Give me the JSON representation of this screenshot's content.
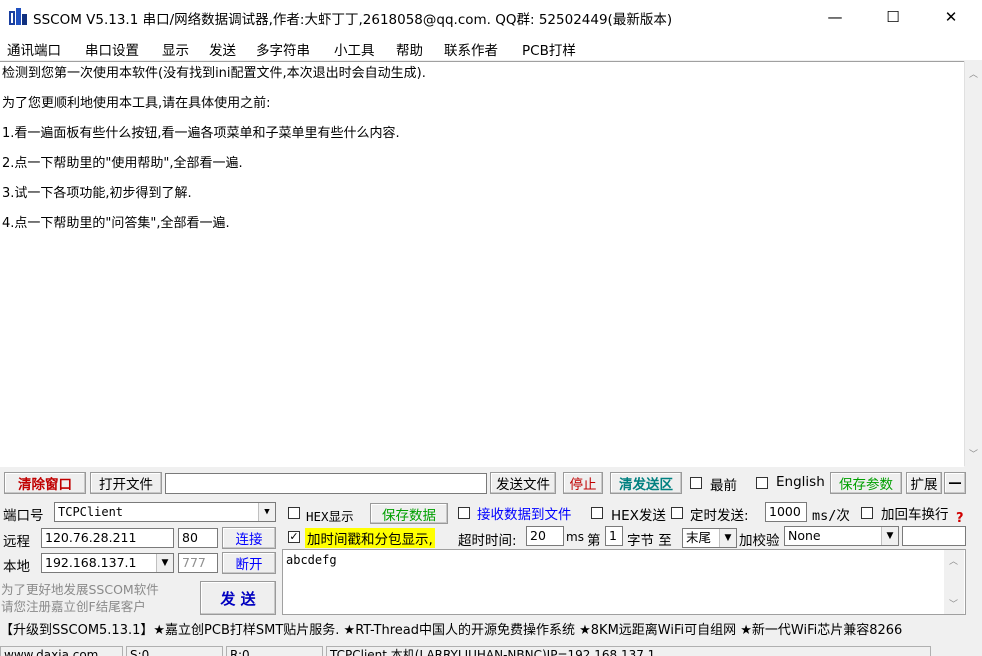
{
  "window": {
    "title": "SSCOM V5.13.1 串口/网络数据调试器,作者:大虾丁丁,2618058@qq.com. QQ群:  52502449(最新版本)",
    "minimize_glyph": "—",
    "maximize_glyph": "☐",
    "close_glyph": "✕"
  },
  "menu": [
    "通讯端口",
    "串口设置",
    "显示",
    "发送",
    "多字符串",
    "小工具",
    "帮助",
    "联系作者",
    "PCB打样"
  ],
  "receive": {
    "lines": [
      "检测到您第一次使用本软件(没有找到ini配置文件,本次退出时会自动生成).",
      "为了您更顺利地使用本工具,请在具体使用之前:",
      "1.看一遍面板有些什么按钮,看一遍各项菜单和子菜单里有些什么内容.",
      "2.点一下帮助里的\"使用帮助\",全部看一遍.",
      "3.试一下各项功能,初步得到了解.",
      "4.点一下帮助里的\"问答集\",全部看一遍."
    ]
  },
  "toolbar": {
    "clear_window": "清除窗口",
    "open_file": "打开文件",
    "file_path": "",
    "send_file": "发送文件",
    "stop": "停止",
    "clear_send": "清发送区",
    "topmost": "最前",
    "english": "English",
    "save_params": "保存参数",
    "expand": "扩展",
    "collapse": "—"
  },
  "connection": {
    "port_label": "端口号",
    "port_value": "TCPClient",
    "remote_label": "远程",
    "remote_ip": "120.76.28.211",
    "remote_port": "80",
    "connect": "连接",
    "local_label": "本地",
    "local_ip": "192.168.137.1",
    "local_port": "777",
    "disconnect": "断开",
    "promo": "为了更好地发展SSCOM软件\n请您注册嘉立创F结尾客户",
    "send": "发 送"
  },
  "options": {
    "hex_display": "HEX显示",
    "save_data": "保存数据",
    "recv_to_file": "接收数据到文件",
    "hex_send": "HEX发送",
    "timed_send": "定时发送:",
    "interval": "1000",
    "interval_unit": "ms/次",
    "add_crlf": "加回车换行",
    "timestamp": "加时间戳和分包显示,",
    "timeout_label": "超时时间:",
    "timeout_value": "20",
    "timeout_unit": "ms",
    "byte_prefix": "第",
    "byte_value": "1",
    "byte_to": "字节 至",
    "end_value": "末尾",
    "checksum_label": "加校验",
    "checksum_value": "None",
    "help_mark": "?"
  },
  "send_area": {
    "text": "abcdefg"
  },
  "ticker": "【升级到SSCOM5.13.1】★嘉立创PCB打样SMT贴片服务. ★RT-Thread中国人的开源免费操作系统 ★8KM远距离WiFi可自组网 ★新一代WiFi芯片兼容8266",
  "status": {
    "website": "www.daxia.com",
    "sent": "S:0",
    "received": "R:0",
    "connection_info": "TCPClient 本机(LARRYLIUHAN-NBNC)IP=192.168.137.1"
  }
}
